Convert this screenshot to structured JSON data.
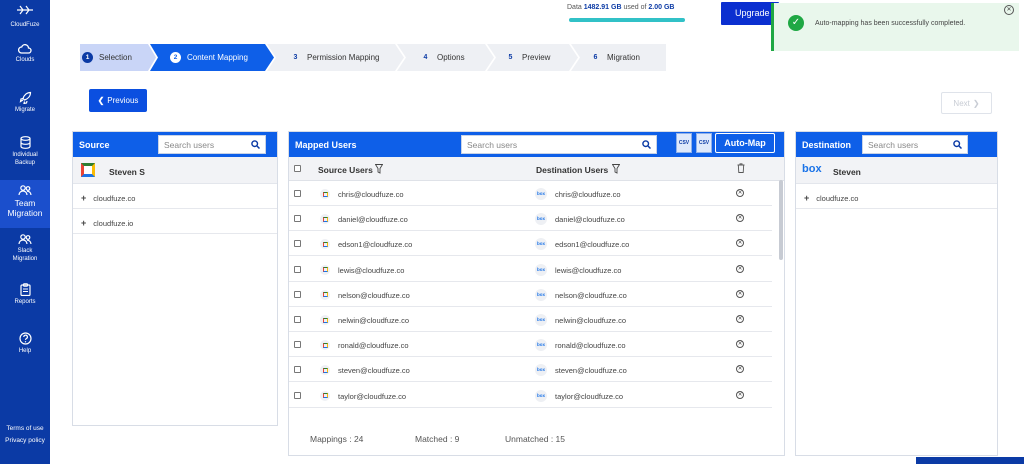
{
  "sidebar": {
    "brand": "CloudFuze",
    "items": [
      {
        "label": "Clouds"
      },
      {
        "label": "Migrate"
      },
      {
        "label": "Individual Backup"
      },
      {
        "label": "Team Migration"
      },
      {
        "label": "Slack Migration"
      },
      {
        "label": "Reports"
      },
      {
        "label": "Help"
      }
    ],
    "terms": "Terms of use",
    "privacy": "Privacy policy"
  },
  "usage": {
    "prefix": "Data",
    "used": "1482.91 GB",
    "middle": "used of",
    "total": "2.00 GB",
    "bar_fraction": 1.0
  },
  "upgrade_label": "Upgrade",
  "toast": {
    "message": "Auto-mapping has been successfully completed.",
    "color": "#1fa844"
  },
  "steps": [
    {
      "num": "1",
      "label": "Selection"
    },
    {
      "num": "2",
      "label": "Content Mapping"
    },
    {
      "num": "3",
      "label": "Permission Mapping"
    },
    {
      "num": "4",
      "label": "Options"
    },
    {
      "num": "5",
      "label": "Preview"
    },
    {
      "num": "6",
      "label": "Migration"
    }
  ],
  "previous_label": "Previous",
  "next_label": "Next",
  "source": {
    "title": "Source",
    "search_placeholder": "Search users",
    "account": "Steven S",
    "domains": [
      "cloudfuze.co",
      "cloudfuze.io"
    ]
  },
  "mapped": {
    "title": "Mapped Users",
    "search_placeholder": "Search users",
    "csv_label": "CSV",
    "automap_label": "Auto-Map",
    "col_source": "Source Users",
    "col_destination": "Destination Users",
    "rows": [
      {
        "source": "chris@cloudfuze.co",
        "destination": "chris@cloudfuze.co"
      },
      {
        "source": "daniel@cloudfuze.co",
        "destination": "daniel@cloudfuze.co"
      },
      {
        "source": "edson1@cloudfuze.co",
        "destination": "edson1@cloudfuze.co"
      },
      {
        "source": "lewis@cloudfuze.co",
        "destination": "lewis@cloudfuze.co"
      },
      {
        "source": "nelson@cloudfuze.co",
        "destination": "nelson@cloudfuze.co"
      },
      {
        "source": "nelwin@cloudfuze.co",
        "destination": "nelwin@cloudfuze.co"
      },
      {
        "source": "ronald@cloudfuze.co",
        "destination": "ronald@cloudfuze.co"
      },
      {
        "source": "steven@cloudfuze.co",
        "destination": "steven@cloudfuze.co"
      },
      {
        "source": "taylor@cloudfuze.co",
        "destination": "taylor@cloudfuze.co"
      }
    ],
    "mappings": "Mappings : 24",
    "matched": "Matched : 9",
    "unmatched": "Unmatched : 15"
  },
  "destination": {
    "title": "Destination",
    "search_placeholder": "Search users",
    "logo_text": "box",
    "account": "Steven",
    "domains": [
      "cloudfuze.co"
    ]
  },
  "colors": {
    "sidebar": "#0b3aa5",
    "accent": "#0e5fe8",
    "step_active": "#c9d5f7",
    "step_current": "#0b3aa5"
  }
}
